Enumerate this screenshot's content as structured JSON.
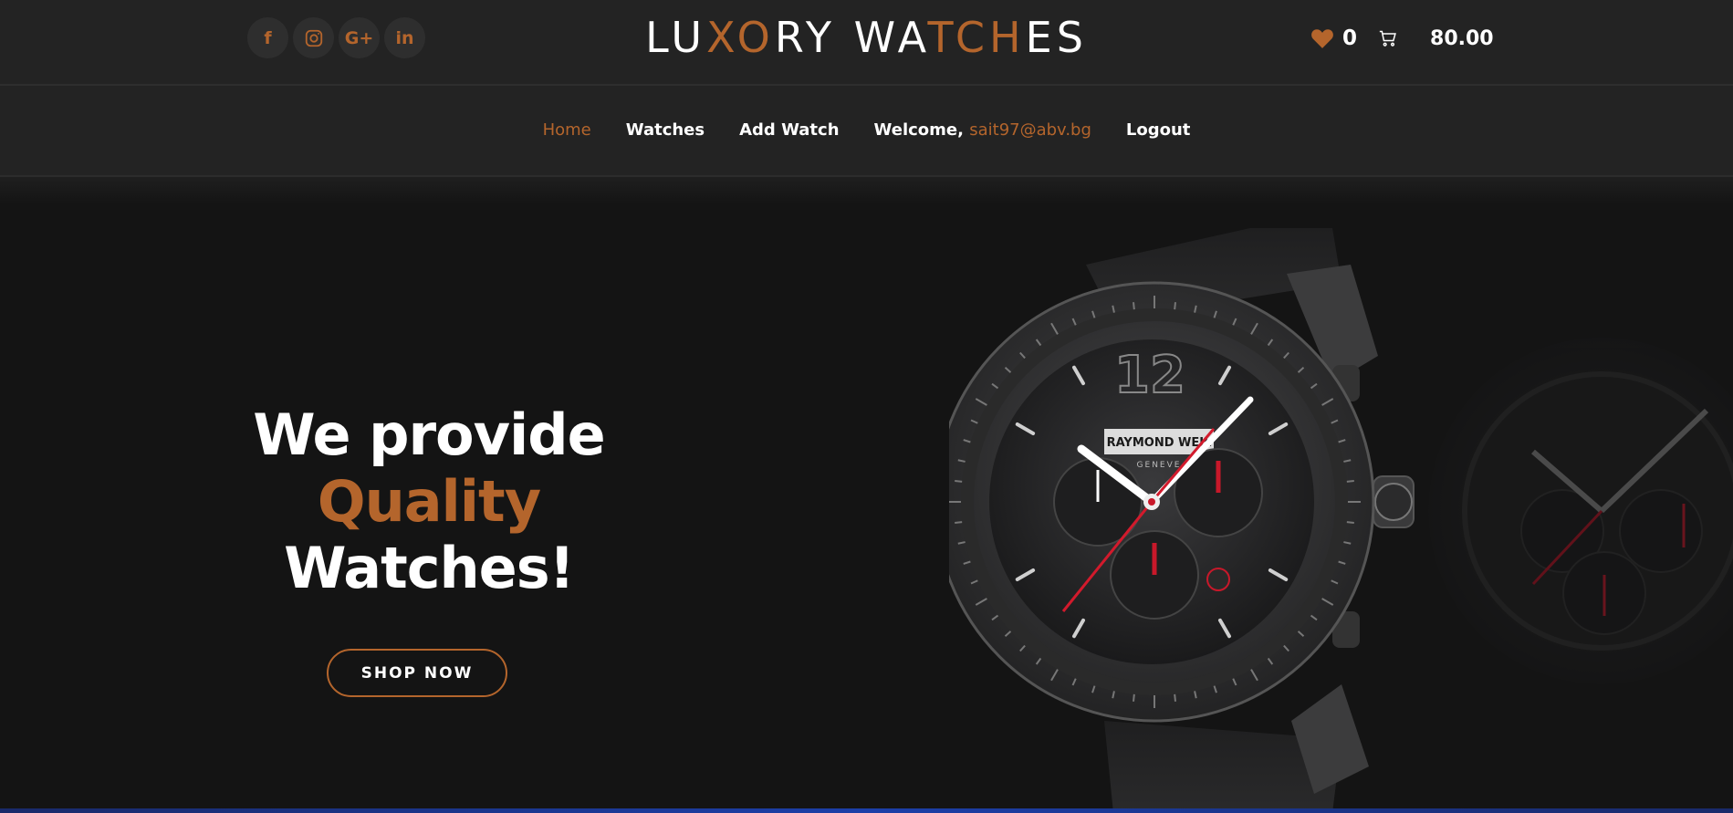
{
  "header": {
    "brand": {
      "p1": "LU",
      "p2": "XO",
      "p3": "RY WA",
      "p4": "TCH",
      "p5": "ES"
    },
    "socials": [
      {
        "name": "facebook",
        "glyph": "f"
      },
      {
        "name": "instagram",
        "glyph": ""
      },
      {
        "name": "google-plus",
        "glyph": "G+"
      },
      {
        "name": "linkedin",
        "glyph": "in"
      }
    ],
    "wishlist_count": "0",
    "cart_total": "80.00"
  },
  "nav": {
    "home": "Home",
    "watches": "Watches",
    "add_watch": "Add Watch",
    "welcome": "Welcome, ",
    "email": "sait97@abv.bg",
    "logout": "Logout"
  },
  "hero": {
    "line1": "We provide",
    "line2": "Quality",
    "line3": "Watches!",
    "cta": "SHOP NOW"
  },
  "watch_image": {
    "brand_text": "RAYMOND WEIL",
    "sub_text": "GENEVE",
    "twelve": "12"
  },
  "colors": {
    "accent": "#b4652c",
    "background": "#141414",
    "header": "#232323"
  }
}
